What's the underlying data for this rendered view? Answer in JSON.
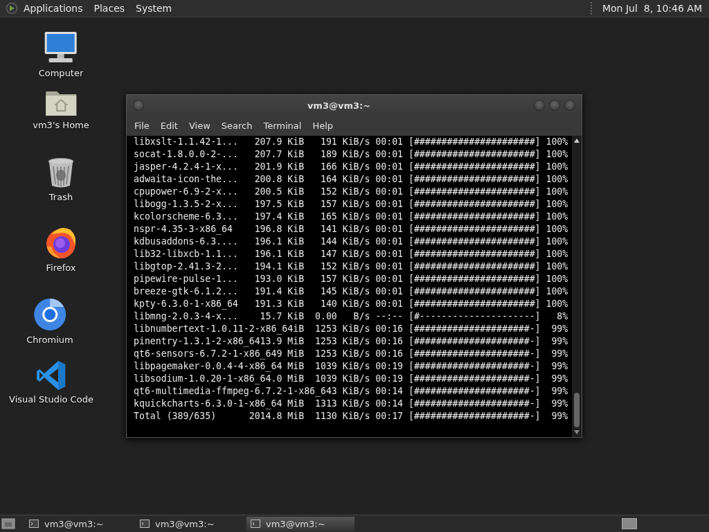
{
  "top_panel": {
    "menus": [
      "Applications",
      "Places",
      "System"
    ],
    "clock": "Mon Jul  8, 10:46 AM"
  },
  "desktop_icons": [
    {
      "label": "Computer",
      "kind": "computer"
    },
    {
      "label": "vm3's Home",
      "kind": "home"
    },
    {
      "label": "Trash",
      "kind": "trash"
    },
    {
      "label": "Firefox",
      "kind": "firefox"
    },
    {
      "label": "Chromium",
      "kind": "chromium"
    },
    {
      "label": "Visual Studio Code",
      "kind": "vscode"
    }
  ],
  "terminal_window": {
    "title": "vm3@vm3:~",
    "menu": [
      "File",
      "Edit",
      "View",
      "Search",
      "Terminal",
      "Help"
    ],
    "lines": [
      "libxslt-1.1.42-1...   207.9 KiB   191 KiB/s 00:01 [######################] 100%",
      "socat-1.8.0.0-2-...   207.7 KiB   189 KiB/s 00:01 [######################] 100%",
      "jasper-4.2.4-1-x...   201.9 KiB   166 KiB/s 00:01 [######################] 100%",
      "adwaita-icon-the...   200.8 KiB   164 KiB/s 00:01 [######################] 100%",
      "cpupower-6.9-2-x...   200.5 KiB   152 KiB/s 00:01 [######################] 100%",
      "libogg-1.3.5-2-x...   197.5 KiB   157 KiB/s 00:01 [######################] 100%",
      "kcolorscheme-6.3...   197.4 KiB   165 KiB/s 00:01 [######################] 100%",
      "nspr-4.35-3-x86_64    196.8 KiB   141 KiB/s 00:01 [######################] 100%",
      "kdbusaddons-6.3....   196.1 KiB   144 KiB/s 00:01 [######################] 100%",
      "lib32-libxcb-1.1...   196.1 KiB   147 KiB/s 00:01 [######################] 100%",
      "libgtop-2.41.3-2...   194.1 KiB   152 KiB/s 00:01 [######################] 100%",
      "pipewire-pulse-1...   193.0 KiB   157 KiB/s 00:01 [######################] 100%",
      "breeze-gtk-6.1.2...   191.4 KiB   145 KiB/s 00:01 [######################] 100%",
      "kpty-6.3.0-1-x86_64   191.3 KiB   140 KiB/s 00:01 [######################] 100%",
      "libmng-2.0.3-4-x...    15.7 KiB  0.00   B/s --:-- [#---------------------]   8%",
      "libnumbertext-1.0.11-2-x86_64iB  1253 KiB/s 00:16 [#####################-]  99%",
      "pinentry-1.3.1-2-x86_6413.9 MiB  1253 KiB/s 00:16 [#####################-]  99%",
      "qt6-sensors-6.7.2-1-x86_649 MiB  1253 KiB/s 00:16 [#####################-]  99%",
      "libpagemaker-0.0.4-4-x86_64 MiB  1039 KiB/s 00:19 [#####################-]  99%",
      "libsodium-1.0.20-1-x86_64.0 MiB  1039 KiB/s 00:19 [#####################-]  99%",
      "qt6-multimedia-ffmpeg-6.7.2-1-x86_643 KiB/s 00:14 [#####################-]  99%",
      "kquickcharts-6.3.0-1-x86_64 MiB  1313 KiB/s 00:14 [#####################-]  99%",
      "Total (389/635)      2014.8 MiB  1130 KiB/s 00:17 [#####################-]  99%"
    ]
  },
  "taskbar": {
    "items": [
      {
        "label": "vm3@vm3:~",
        "selected": false
      },
      {
        "label": "vm3@vm3:~",
        "selected": false
      },
      {
        "label": "vm3@vm3:~",
        "selected": true
      }
    ]
  }
}
